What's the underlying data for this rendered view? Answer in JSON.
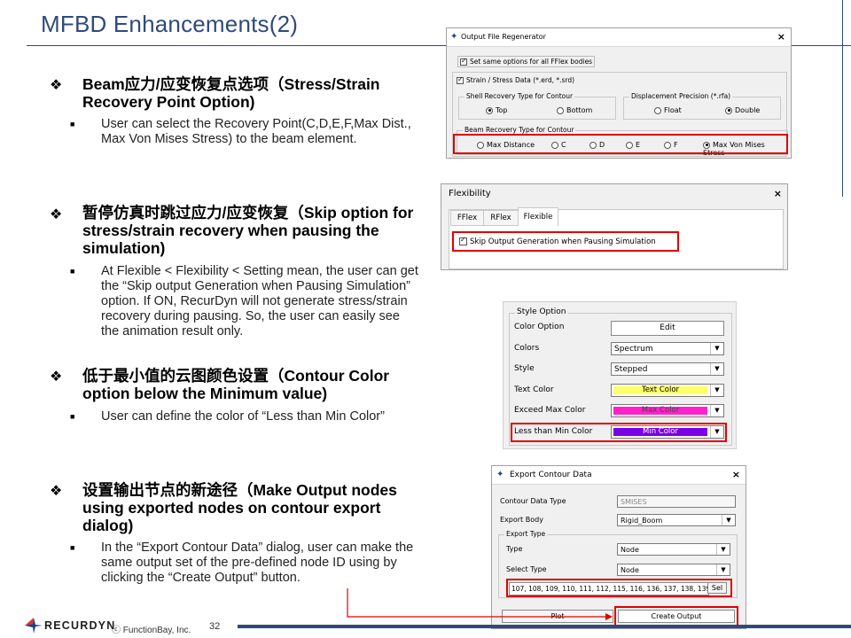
{
  "title": "MFBD Enhancements(2)",
  "sections": [
    {
      "heading": "Beam应力/应变恢复点选项（Stress/Strain Recovery Point Option)",
      "body": "User can select the Recovery Point(C,D,E,F,Max Dist., Max Von Mises Stress) to the beam element."
    },
    {
      "heading": "暂停仿真时跳过应力/应变恢复（Skip option for stress/strain recovery when pausing the simulation)",
      "body": "At Flexible < Flexibility < Setting mean, the user can get the “Skip output Generation when Pausing Simulation” option. If ON, RecurDyn will not generate stress/strain recovery during pausing. So, the user can easily see the animation result only."
    },
    {
      "heading": "低于最小值的云图颜色设置（Contour Color option below the Minimum value)",
      "body": "User can define the color of “Less than Min Color”"
    },
    {
      "heading": "设置输出节点的新途径（Make Output nodes using exported nodes on contour export dialog)",
      "body": "In the “Export Contour Data” dialog, user can make the same output set of the pre-defined node ID using by clicking the “Create Output” button."
    }
  ],
  "ofr": {
    "title": "Output File Regenerator",
    "same_opts": "Set same options for all FFlex bodies",
    "strain_stress": "Strain / Stress Data (*.erd, *.srd)",
    "shell_group": "Shell Recovery Type for Contour",
    "shell_top": "Top",
    "shell_bottom": "Bottom",
    "disp_group": "Displacement Precision (*.rfa)",
    "disp_float": "Float",
    "disp_double": "Double",
    "beam_group": "Beam Recovery Type for Contour",
    "beam_opts": [
      "Max Distance",
      "C",
      "D",
      "E",
      "F",
      "Max Von Mises Stress"
    ]
  },
  "flex": {
    "title": "Flexibility",
    "tabs": [
      "FFlex",
      "RFlex",
      "Flexible"
    ],
    "skip": "Skip Output Generation when Pausing Simulation"
  },
  "style": {
    "group": "Style Option",
    "rows": [
      {
        "label": "Color Option",
        "value": "Edit"
      },
      {
        "label": "Colors",
        "value": "Spectrum"
      },
      {
        "label": "Style",
        "value": "Stepped"
      },
      {
        "label": "Text Color",
        "value": "Text Color",
        "color": "#ffff66"
      },
      {
        "label": "Exceed Max Color",
        "value": "Max Color",
        "color": "#ff22cc"
      },
      {
        "label": "Less than Min Color",
        "value": "Min Color",
        "color": "#7a00e6"
      }
    ]
  },
  "export": {
    "title": "Export Contour Data",
    "contour_type_label": "Contour Data Type",
    "contour_type_value": "SMISES",
    "export_body_label": "Export Body",
    "export_body_value": "Rigid_Boom",
    "group": "Export Type",
    "type_label": "Type",
    "type_value": "Node",
    "select_label": "Select Type",
    "select_value": "Node",
    "nodes": "107, 108, 109, 110, 111, 112, 115, 116, 136, 137, 138, 139,",
    "sel_button": "Sel",
    "plot_button": "Plot",
    "create_button": "Create Output"
  },
  "footer": {
    "logo": "RECURDYN",
    "copyright": "ⓒ FunctionBay, Inc.",
    "page": "32"
  },
  "colors": {
    "accent": "#2f4a7a",
    "highlight": "#e00000"
  }
}
